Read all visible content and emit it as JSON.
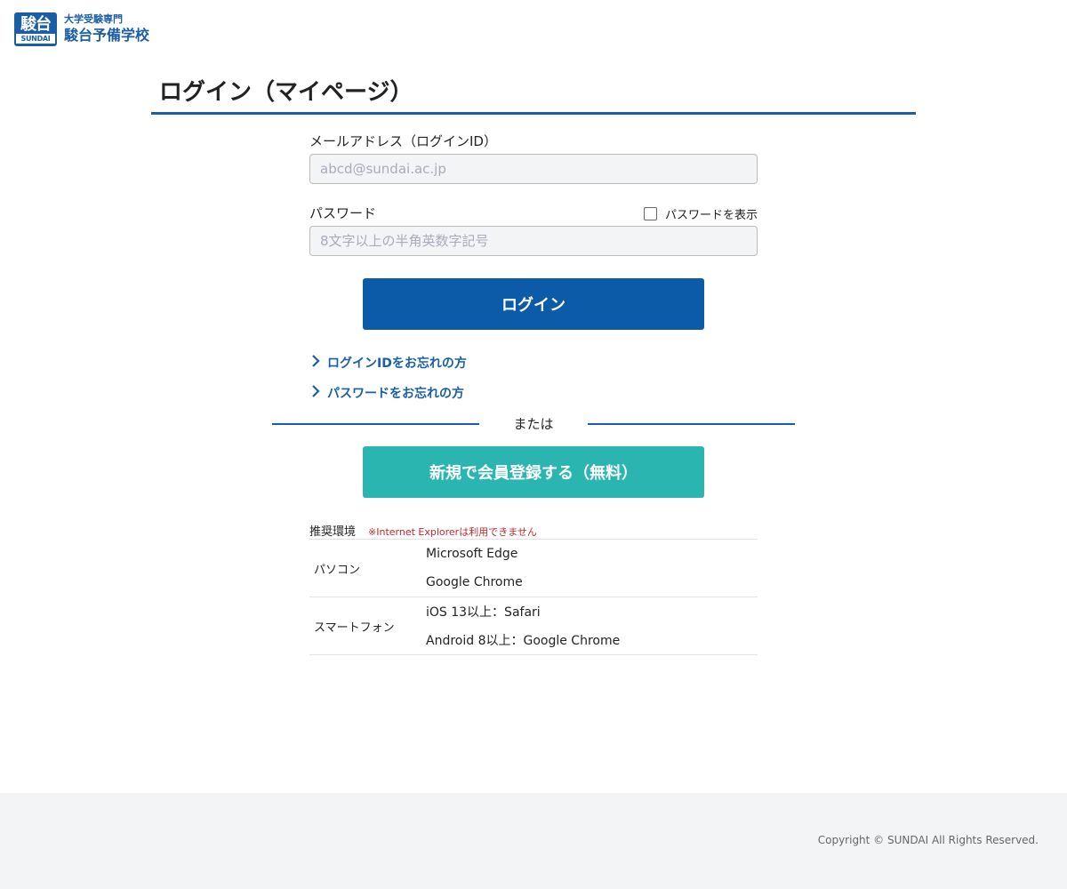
{
  "header": {
    "logo_kanji": "駿台",
    "logo_en": "SUNDAI",
    "logo_sub": "大学受験専門",
    "logo_main": "駿台予備学校"
  },
  "page": {
    "title": "ログイン（マイページ）"
  },
  "form": {
    "email_label": "メールアドレス（ログインID）",
    "email_placeholder": "abcd@sundai.ac.jp",
    "email_value": "",
    "password_label": "パスワード",
    "password_placeholder": "8文字以上の半角英数字記号",
    "password_value": "",
    "show_password_label": "パスワードを表示",
    "show_password_checked": false,
    "login_button": "ログイン",
    "forgot_id": "ログインIDをお忘れの方",
    "forgot_password": "パスワードをお忘れの方",
    "divider_text": "または",
    "register_button": "新規で会員登録する（無料）"
  },
  "environment": {
    "title": "推奨環境",
    "warning": "※Internet Explorerは利用できません",
    "rows": [
      {
        "device": "パソコン",
        "items": [
          "Microsoft Edge",
          "Google Chrome"
        ]
      },
      {
        "device": "スマートフォン",
        "items": [
          "iOS 13以上：Safari",
          "Android 8以上：Google Chrome"
        ]
      }
    ]
  },
  "footer": {
    "copyright": "Copyright © SUNDAI All Rights Reserved."
  },
  "colors": {
    "brand": "#1a5fa6",
    "login_button": "#0b5ba9",
    "register_button": "#2bb5b0",
    "warning": "#c0282d"
  },
  "icons": [
    "chevron-right-icon"
  ]
}
